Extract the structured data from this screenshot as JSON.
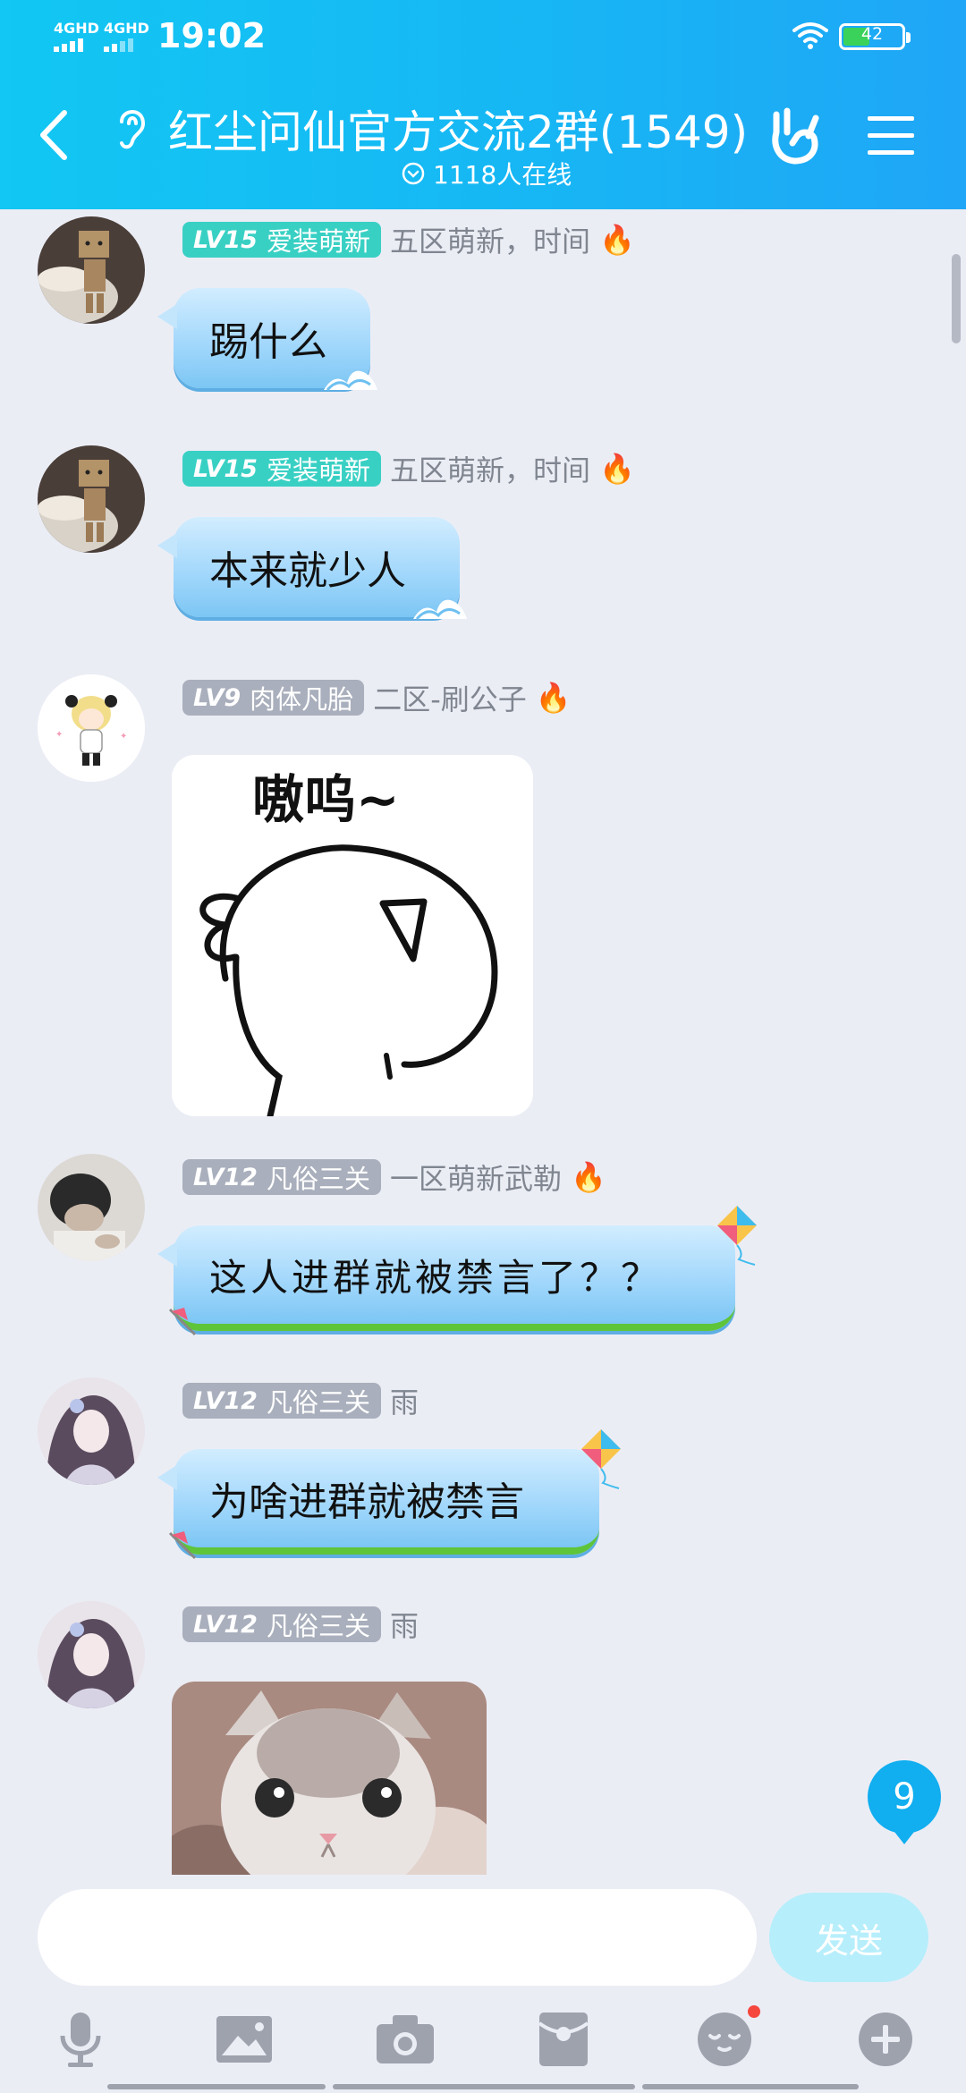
{
  "status_bar": {
    "network_1": "4GHD",
    "network_2": "4GHD",
    "time": "19:02",
    "battery": "42"
  },
  "header": {
    "title": "红尘问仙官方交流2群(1549)",
    "online": "1118人在线"
  },
  "messages": [
    {
      "level_badge": "LV15",
      "level_title": "爱装萌新",
      "badge_style": "teal",
      "nickname": "五区萌新，时间",
      "fire": "🔥",
      "type": "text",
      "text": "踢什么"
    },
    {
      "level_badge": "LV15",
      "level_title": "爱装萌新",
      "badge_style": "teal",
      "nickname": "五区萌新，时间",
      "fire": "🔥",
      "type": "text",
      "text": "本来就少人"
    },
    {
      "level_badge": "LV9",
      "level_title": "肉体凡胎",
      "badge_style": "gray",
      "nickname": "二区-刷公子",
      "fire": "🔥",
      "type": "sticker",
      "sticker_text": "嗷呜~"
    },
    {
      "level_badge": "LV12",
      "level_title": "凡俗三关",
      "badge_style": "gray",
      "nickname": "一区萌新武勒",
      "fire": "🔥",
      "type": "text",
      "text": "这人进群就被禁言了？？"
    },
    {
      "level_badge": "LV12",
      "level_title": "凡俗三关",
      "badge_style": "gray",
      "nickname": "雨",
      "type": "text",
      "text": "为啥进群就被禁言"
    },
    {
      "level_badge": "LV12",
      "level_title": "凡俗三关",
      "badge_style": "gray",
      "nickname": "雨",
      "type": "image"
    }
  ],
  "unread_count": "9",
  "input": {
    "value": "",
    "send_label": "发送"
  },
  "toolbar": {
    "items": [
      "microphone-icon",
      "image-icon",
      "camera-icon",
      "red-packet-icon",
      "emoji-icon",
      "plus-icon"
    ]
  },
  "colors": {
    "header_gradient_start": "#12c7f3",
    "header_gradient_end": "#1fa6f6",
    "bubble": "#9fd6fb",
    "level_teal": "#39d0c4",
    "level_gray": "#a9afbc",
    "send_button": "#b7eefb",
    "unread_badge": "#11aef0",
    "background": "#ebedf5"
  }
}
